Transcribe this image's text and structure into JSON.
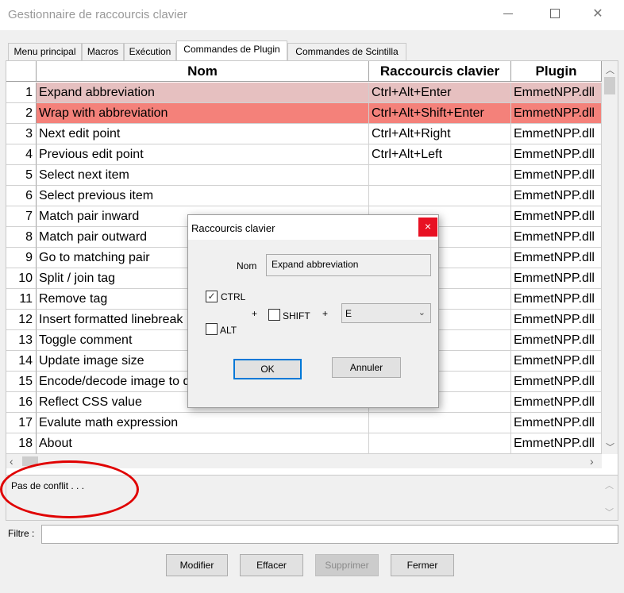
{
  "window": {
    "title": "Gestionnaire de raccourcis clavier"
  },
  "tabs": [
    {
      "label": "Menu principal"
    },
    {
      "label": "Macros"
    },
    {
      "label": "Exécution"
    },
    {
      "label": "Commandes de Plugin",
      "active": true
    },
    {
      "label": "Commandes de Scintilla"
    }
  ],
  "table": {
    "headers": {
      "name": "Nom",
      "shortcut": "Raccourcis clavier",
      "plugin": "Plugin"
    },
    "rows": [
      {
        "num": "1",
        "name": "Expand abbreviation",
        "shortcut": "Ctrl+Alt+Enter",
        "plugin": "EmmetNPP.dll"
      },
      {
        "num": "2",
        "name": "Wrap with abbreviation",
        "shortcut": "Ctrl+Alt+Shift+Enter",
        "plugin": "EmmetNPP.dll"
      },
      {
        "num": "3",
        "name": "Next edit point",
        "shortcut": "Ctrl+Alt+Right",
        "plugin": "EmmetNPP.dll"
      },
      {
        "num": "4",
        "name": "Previous edit point",
        "shortcut": "Ctrl+Alt+Left",
        "plugin": "EmmetNPP.dll"
      },
      {
        "num": "5",
        "name": "Select next item",
        "shortcut": "",
        "plugin": "EmmetNPP.dll"
      },
      {
        "num": "6",
        "name": "Select previous item",
        "shortcut": "",
        "plugin": "EmmetNPP.dll"
      },
      {
        "num": "7",
        "name": "Match pair inward",
        "shortcut": "",
        "plugin": "EmmetNPP.dll"
      },
      {
        "num": "8",
        "name": "Match pair outward",
        "shortcut": "",
        "plugin": "EmmetNPP.dll"
      },
      {
        "num": "9",
        "name": "Go to matching pair",
        "shortcut": "",
        "plugin": "EmmetNPP.dll"
      },
      {
        "num": "10",
        "name": "Split / join tag",
        "shortcut": "",
        "plugin": "EmmetNPP.dll"
      },
      {
        "num": "11",
        "name": "Remove tag",
        "shortcut": "",
        "plugin": "EmmetNPP.dll"
      },
      {
        "num": "12",
        "name": "Insert formatted linebreak",
        "shortcut": "",
        "plugin": "EmmetNPP.dll"
      },
      {
        "num": "13",
        "name": "Toggle comment",
        "shortcut": "",
        "plugin": "EmmetNPP.dll"
      },
      {
        "num": "14",
        "name": "Update image size",
        "shortcut": "",
        "plugin": "EmmetNPP.dll"
      },
      {
        "num": "15",
        "name": "Encode/decode image to d",
        "shortcut": "",
        "plugin": "EmmetNPP.dll"
      },
      {
        "num": "16",
        "name": "Reflect CSS value",
        "shortcut": "",
        "plugin": "EmmetNPP.dll"
      },
      {
        "num": "17",
        "name": "Evalute math expression",
        "shortcut": "",
        "plugin": "EmmetNPP.dll"
      },
      {
        "num": "18",
        "name": "About",
        "shortcut": "",
        "plugin": "EmmetNPP.dll"
      }
    ]
  },
  "status": {
    "text": "Pas de conflit . . ."
  },
  "filter": {
    "label": "Filtre :",
    "value": ""
  },
  "buttons": {
    "modify": "Modifier",
    "clear": "Effacer",
    "delete": "Supprimer",
    "close": "Fermer"
  },
  "dialog": {
    "title": "Raccourcis clavier",
    "close_glyph": "×",
    "name_label": "Nom",
    "name_value": "Expand abbreviation",
    "ctrl_label": "CTRL",
    "ctrl_checked": true,
    "alt_label": "ALT",
    "alt_checked": false,
    "shift_label": "SHIFT",
    "shift_checked": false,
    "plus": "+",
    "key_value": "E",
    "ok_label": "OK",
    "cancel_label": "Annuler"
  },
  "colors": {
    "row_selected_light": "#e6c0c0",
    "row_selected_strong": "#f4817a",
    "annotation": "#e00000",
    "close_red": "#e81123"
  }
}
